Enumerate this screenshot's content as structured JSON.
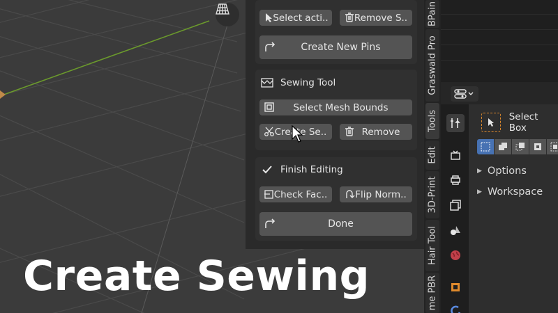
{
  "viewport": {
    "gizmo_icon": "grid-perspective-icon"
  },
  "npanel": {
    "pins_row": {
      "select_label": "Select acti..",
      "remove_label": "Remove S..",
      "create_pins_label": "Create New Pins"
    },
    "sewing": {
      "title": "Sewing Tool",
      "select_bounds_label": "Select Mesh Bounds",
      "create_label": "Create Se..",
      "remove_label": "Remove"
    },
    "finish": {
      "title": "Finish Editing",
      "check_label": "Check Fac..",
      "flip_label": "Flip Norm..",
      "done_label": "Done"
    }
  },
  "tabs": {
    "items": [
      "BPain",
      "Graswald Pro",
      "Tools",
      "Edit",
      "3D-Print",
      "Hair Tool",
      "me PBR"
    ]
  },
  "properties": {
    "active_tool": "Select Box",
    "sections": [
      "Options",
      "Workspace"
    ]
  },
  "overlay": {
    "title": "Create Sewing"
  },
  "colors": {
    "accent_blue": "#4772b3",
    "tool_orange": "#e08a2c",
    "grid_line": "#4a4a4a",
    "y_axis": "#6b9a2c"
  }
}
